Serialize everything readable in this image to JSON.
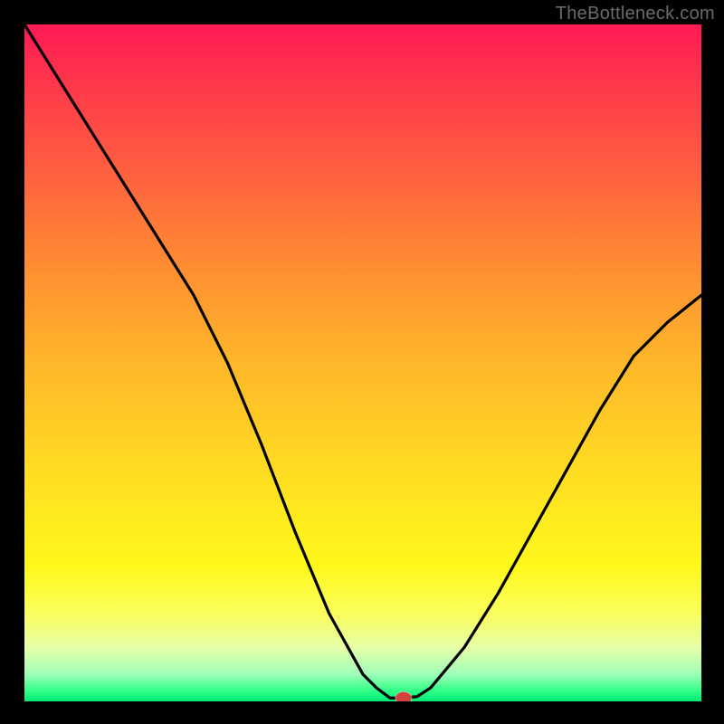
{
  "watermark": "TheBottleneck.com",
  "chart_data": {
    "type": "line",
    "title": "",
    "xlabel": "",
    "ylabel": "",
    "xlim": [
      0,
      100
    ],
    "ylim": [
      0,
      100
    ],
    "x": [
      0,
      5,
      10,
      15,
      20,
      25,
      30,
      35,
      40,
      45,
      50,
      52,
      54,
      56,
      58,
      60,
      65,
      70,
      75,
      80,
      85,
      90,
      95,
      100
    ],
    "y": [
      100,
      92,
      84,
      76,
      68,
      60,
      50,
      38,
      25,
      13,
      4,
      2,
      0.5,
      0.5,
      0.7,
      2,
      8,
      16,
      25,
      34,
      43,
      51,
      56,
      60
    ],
    "marker": {
      "x": 56,
      "y": 0.5,
      "color": "#d2433f"
    },
    "background_gradient": [
      "#ff1a54",
      "#ffe91f",
      "#00e874"
    ]
  }
}
